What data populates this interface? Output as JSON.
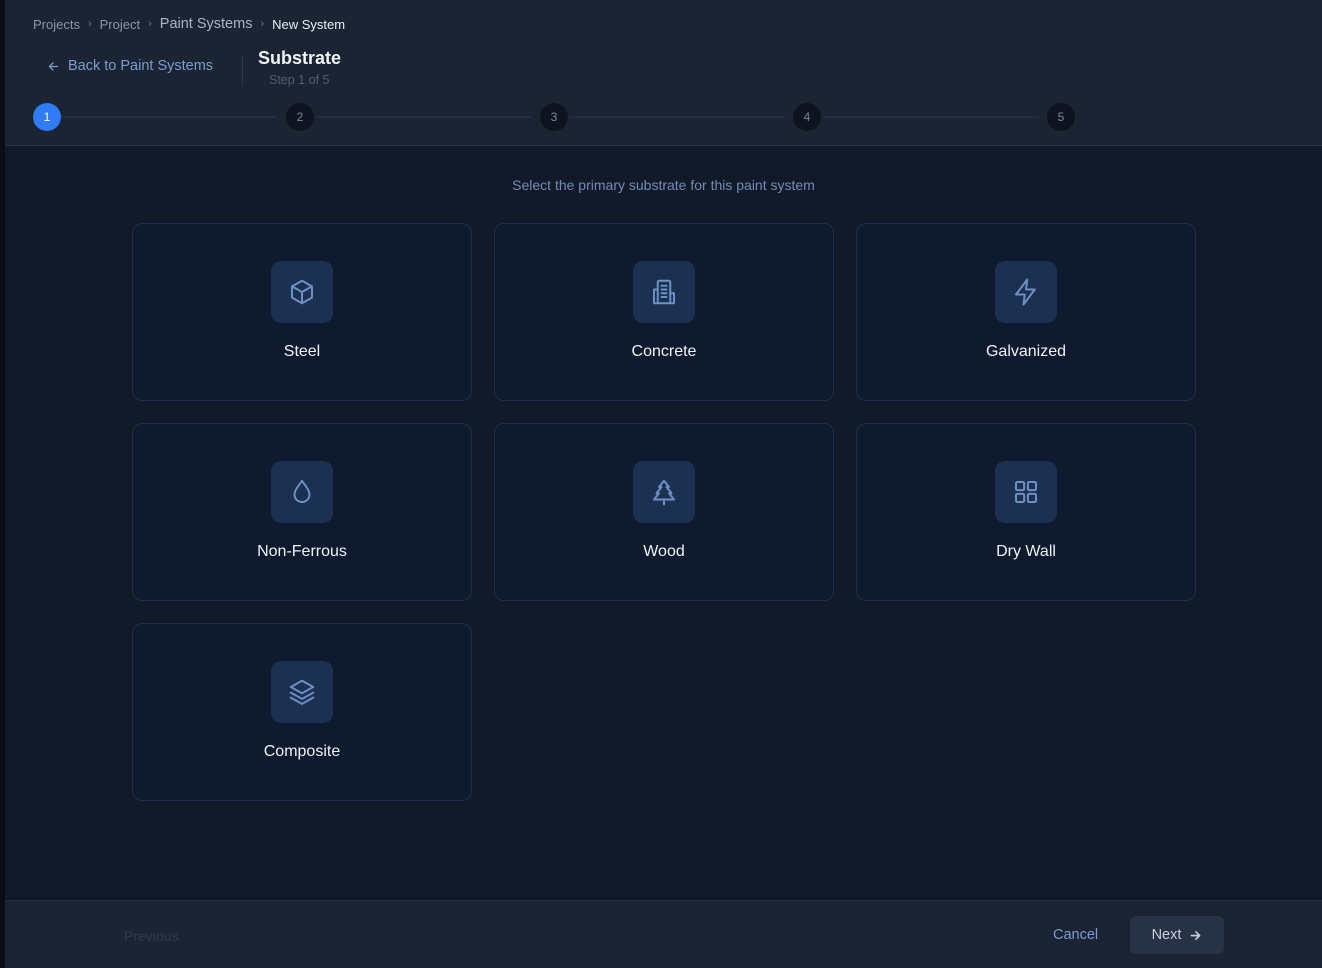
{
  "breadcrumb": {
    "items": [
      "Projects",
      "Project",
      "Paint Systems",
      "New System"
    ],
    "separator": "›"
  },
  "header": {
    "back_label": "Back to Paint Systems",
    "title": "Substrate",
    "subtitle": "Step 1 of 5"
  },
  "stepper": {
    "steps": [
      "1",
      "2",
      "3",
      "4",
      "5"
    ],
    "current_step": 1
  },
  "main": {
    "instruction": "Select the primary substrate for this paint system",
    "options": [
      {
        "label": "Steel",
        "icon": "cube-icon"
      },
      {
        "label": "Concrete",
        "icon": "building-icon"
      },
      {
        "label": "Galvanized",
        "icon": "lightning-icon"
      },
      {
        "label": "Non-Ferrous",
        "icon": "droplet-icon"
      },
      {
        "label": "Wood",
        "icon": "tree-icon"
      },
      {
        "label": "Dry Wall",
        "icon": "grid-icon"
      },
      {
        "label": "Composite",
        "icon": "layers-icon"
      }
    ]
  },
  "footer": {
    "previous_label": "Previous",
    "cancel_label": "Cancel",
    "next_label": "Next"
  },
  "colors": {
    "accent": "#2f7cf6",
    "background": "#121a2a",
    "header": "#1b2433",
    "card": "#0f1a2e",
    "link": "#7b9bd0"
  }
}
